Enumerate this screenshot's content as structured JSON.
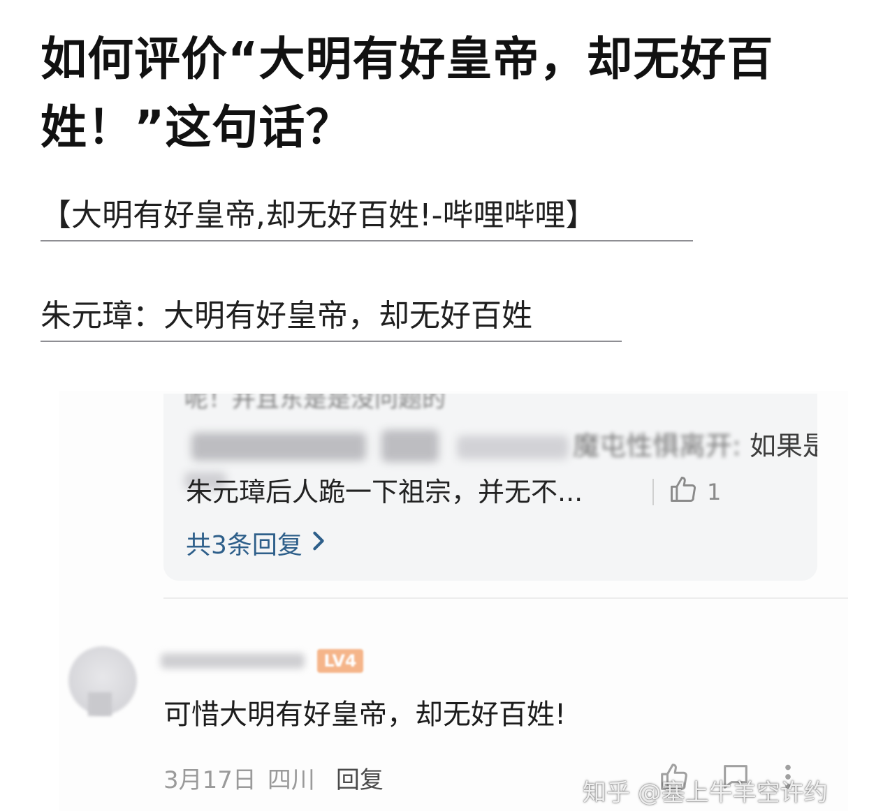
{
  "question": {
    "title": "如何评价“大明有好皇帝，却无好百姓！”这句话？"
  },
  "links": [
    {
      "text": "【大明有好皇帝,却无好百姓!-哔哩哔哩】"
    },
    {
      "text": "朱元璋：大明有好皇帝，却无好百姓"
    }
  ],
  "screenshot": {
    "reply_thread": {
      "author_tail": "魔屯性惧离开:",
      "reply_first": "如果是",
      "reply_text": "朱元璋后人跪一下祖宗，并无不...",
      "like_count": "1",
      "more_replies": "共3条回复",
      "icons": {
        "like": "thumbs-up-icon",
        "more": "chevron-right-icon"
      }
    },
    "comment": {
      "level_badge": "LV4",
      "text": "可惜大明有好皇帝，却无好百姓!",
      "date": "3月17日",
      "location": "四川",
      "reply_label": "回复",
      "icons": {
        "like": "thumbs-up-icon",
        "comment": "comment-icon",
        "more": "more-vertical-icon"
      }
    }
  },
  "watermark": "知乎 @塞上牛羊空许约",
  "colors": {
    "link_underline": "#8e8e93",
    "reply_bg": "#f4f5f6",
    "more_replies": "#2e5f8a",
    "badge": "#f5b58a"
  }
}
